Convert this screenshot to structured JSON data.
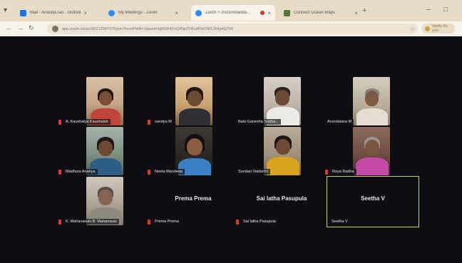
{
  "browser": {
    "tabs": [
      {
        "label": "Mail - Ananda.rao - Outlook",
        "favicon_color": "#1a73e8",
        "active": false
      },
      {
        "label": "My Meetings - Zoom",
        "favicon_color": "#2d8cff",
        "active": false
      },
      {
        "label": "Zoom > 2023/Ananda...",
        "favicon_color": "#2d8cff",
        "active": true,
        "recording": true
      },
      {
        "label": "Connect Ocean Maps",
        "favicon_color": "#4f7a3a",
        "active": false
      }
    ],
    "url": "app.zoom.us/wc/96213947075/join?fromPWA=1&pwd=bjb5W4ZnQ3NpZFRudFhrOWC9Vlg4Q709",
    "profile_label": "Verify it's you"
  },
  "participants": [
    {
      "name": "A. Kaushalya Kaushalsh",
      "muted": true,
      "video": true
    },
    {
      "name": "sandya M",
      "muted": true,
      "video": true
    },
    {
      "name": "Bala Ganesha Subba...",
      "muted": false,
      "video": true
    },
    {
      "name": "Arundalana M",
      "muted": false,
      "video": true
    },
    {
      "name": "Madhura Ananya",
      "muted": true,
      "video": true
    },
    {
      "name": "Neeta Mandeep",
      "muted": true,
      "video": true
    },
    {
      "name": "Sundari Vaidarthi",
      "muted": false,
      "video": true
    },
    {
      "name": "Roya Radha",
      "muted": true,
      "video": true
    },
    {
      "name": "K. Mahavasuki B. Mahamaan",
      "muted": true,
      "video": true
    },
    {
      "name": "Prema Prema",
      "muted": true,
      "video": false,
      "display_name": "Prema Prema"
    },
    {
      "name": "Sai latha Pasupula",
      "muted": true,
      "video": false,
      "display_name": "Sai latha Pasupula"
    },
    {
      "name": "Seetha V",
      "muted": false,
      "video": false,
      "display_name": "Seetha V",
      "speaking": true
    }
  ],
  "colors": {
    "stage_bg": "#0d0d12",
    "speaking_border": "#c8d33f",
    "muted_mic": "#e23b2e"
  }
}
